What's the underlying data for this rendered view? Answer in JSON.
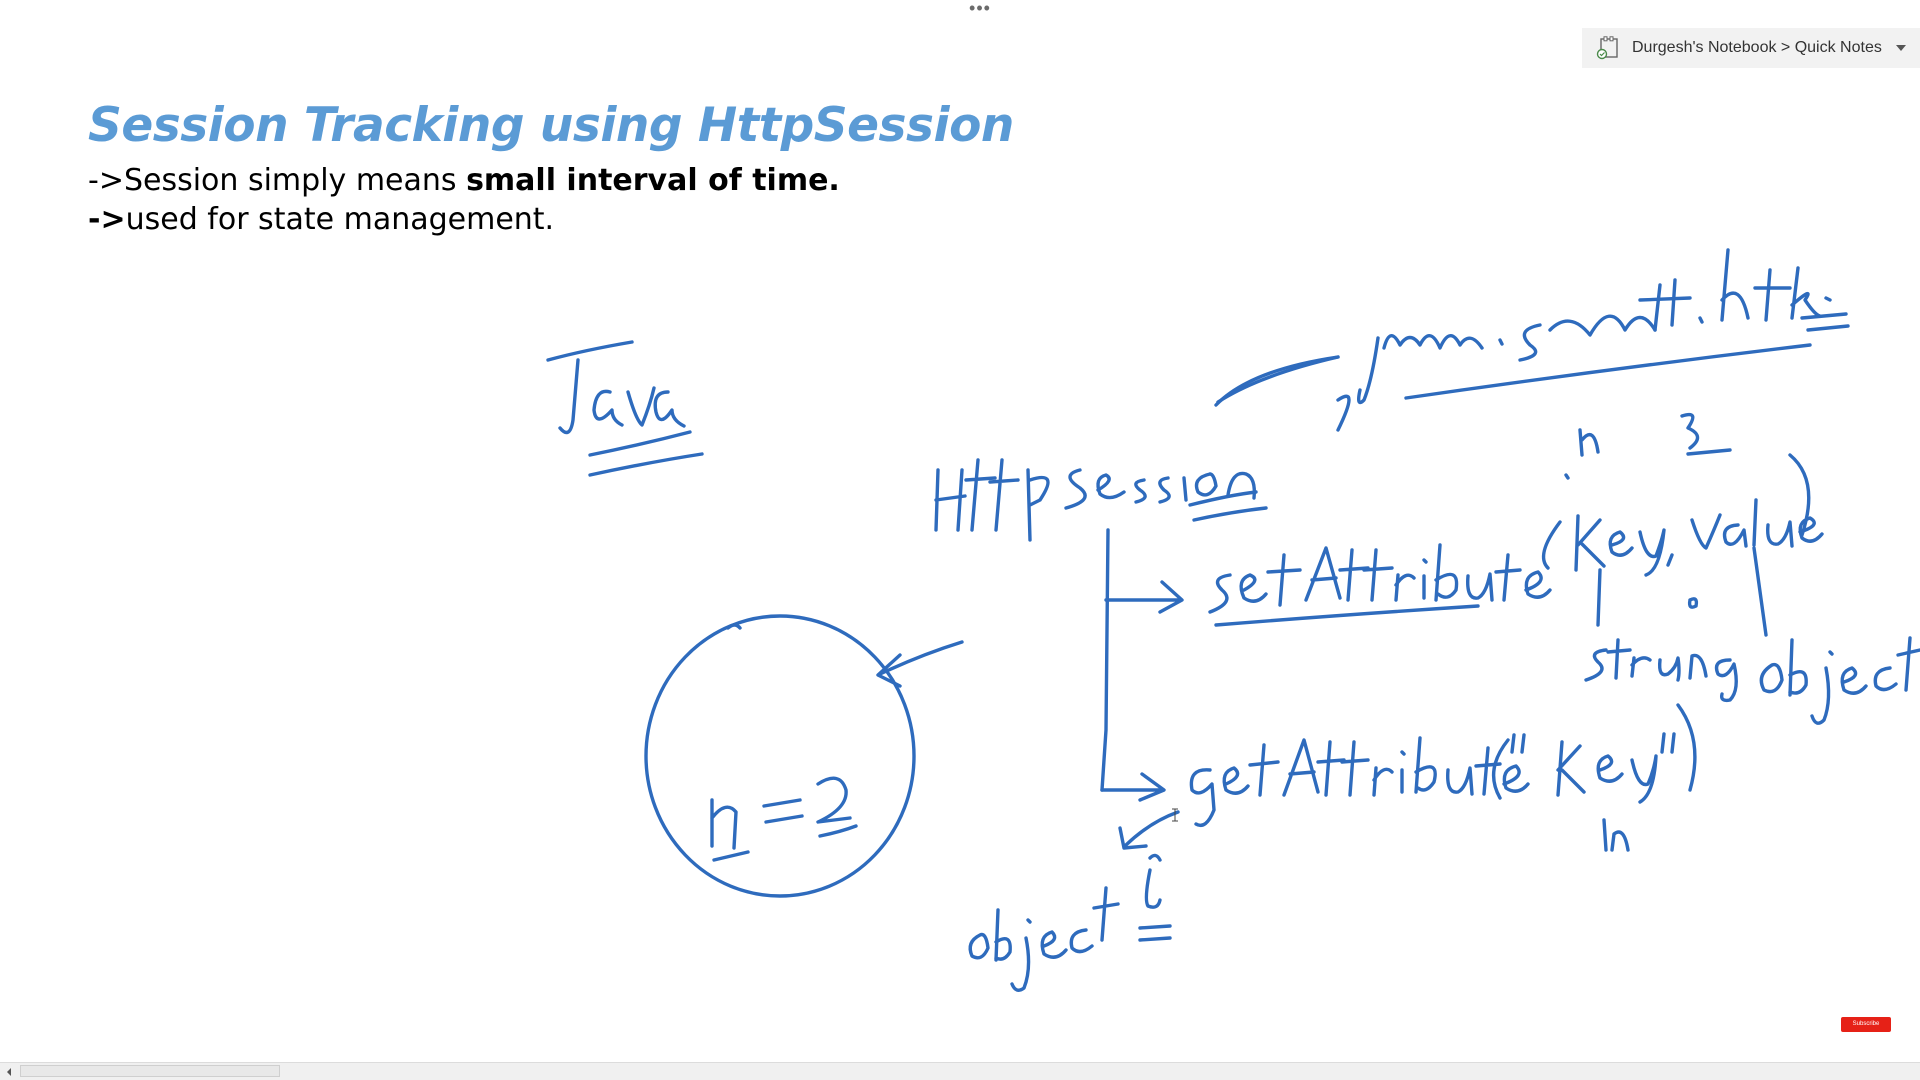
{
  "toolbar": {
    "more_dots": "•••"
  },
  "notebook_picker": {
    "icon": "onenote-notebook-icon",
    "path": "Durgesh's Notebook > Quick Notes"
  },
  "page": {
    "title": "Session Tracking using HttpSession",
    "line1_prefix": "->Session simply means ",
    "line1_bold": "small interval of time.",
    "line2_arrow": "->",
    "line2_rest": "used for state management."
  },
  "ink_notes": {
    "words": [
      "Java",
      "javax.servlet.http",
      "HttpSession",
      "setAttribute(key, value)",
      "getAttribute(\"key\")",
      "String",
      "object",
      "object",
      "n = 2",
      "n",
      "2",
      "n"
    ],
    "ink_color": "#2e6bbd"
  },
  "colors": {
    "title_blue": "#5b9bd5",
    "subscribe_red": "#e62117"
  },
  "subscribe": {
    "label": "Subscribe"
  }
}
